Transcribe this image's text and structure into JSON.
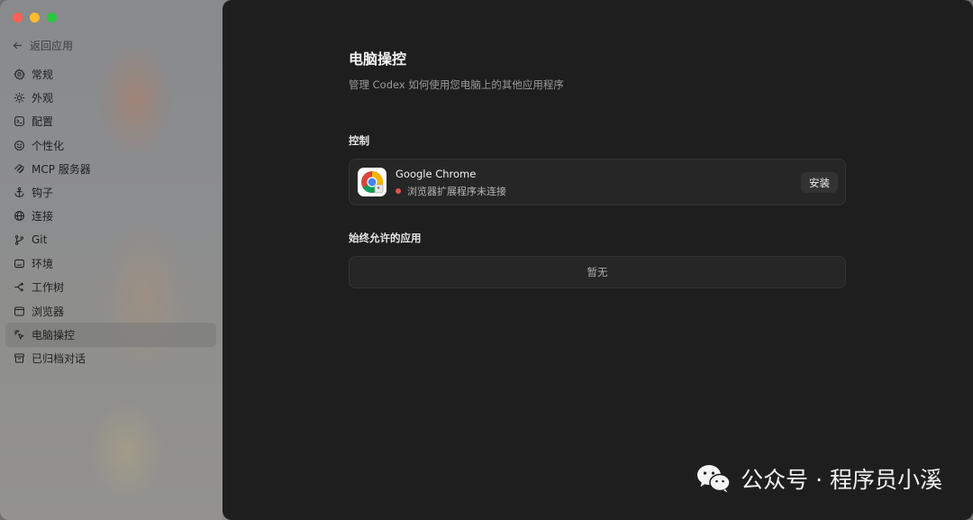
{
  "sidebar": {
    "back_label": "返回应用",
    "items": [
      {
        "label": "常规",
        "icon": "gear-icon"
      },
      {
        "label": "外观",
        "icon": "sun-icon"
      },
      {
        "label": "配置",
        "icon": "terminal-icon"
      },
      {
        "label": "个性化",
        "icon": "smile-icon"
      },
      {
        "label": "MCP 服务器",
        "icon": "mcp-icon"
      },
      {
        "label": "钩子",
        "icon": "anchor-icon"
      },
      {
        "label": "连接",
        "icon": "globe-icon"
      },
      {
        "label": "Git",
        "icon": "branch-icon"
      },
      {
        "label": "环境",
        "icon": "monitor-icon"
      },
      {
        "label": "工作树",
        "icon": "worktree-icon"
      },
      {
        "label": "浏览器",
        "icon": "browser-icon"
      },
      {
        "label": "电脑操控",
        "icon": "cursor-icon",
        "active": true
      },
      {
        "label": "已归档对话",
        "icon": "archive-icon"
      }
    ]
  },
  "main": {
    "title": "电脑操控",
    "subtitle": "管理 Codex 如何使用您电脑上的其他应用程序",
    "control": {
      "label": "控制",
      "app_name": "Google Chrome",
      "status_text": "浏览器扩展程序未连接",
      "status_color": "#e5534b",
      "install_label": "安装",
      "app_icon": "chrome-icon"
    },
    "allowed": {
      "label": "始终允许的应用",
      "empty_text": "暂无"
    }
  },
  "watermark": {
    "text": "公众号 · 程序员小溪",
    "icon": "wechat-icon"
  }
}
